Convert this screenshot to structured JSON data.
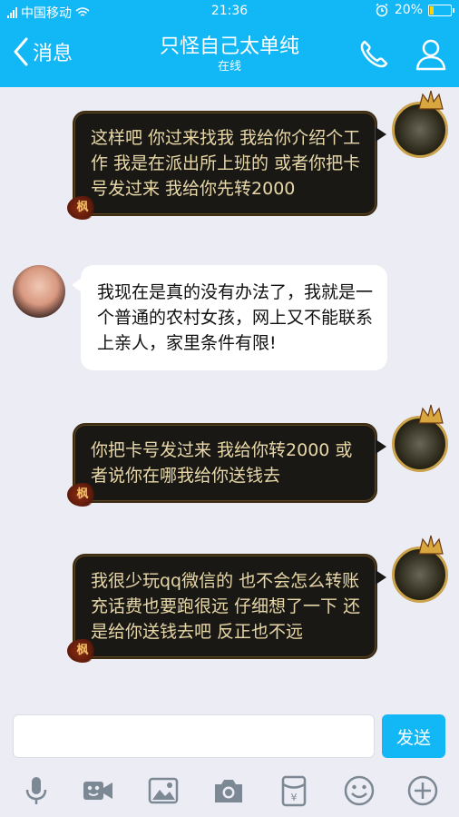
{
  "status": {
    "carrier": "中国移动",
    "time": "21:36",
    "battery": "20%",
    "battery_level": 0.2
  },
  "nav": {
    "back_label": "消息",
    "title": "只怪自己太单纯",
    "subtitle": "在线",
    "phone_icon": "phone-icon",
    "profile_icon": "user-icon"
  },
  "messages": [
    {
      "side": "self",
      "text": "这样吧 你过来找我 我给你介绍个工作 我是在派出所上班的 或者你把卡号发过来 我给你先转2000"
    },
    {
      "side": "other",
      "text": "我现在是真的没有办法了，我就是一个普通的农村女孩，网上又不能联系上亲人，家里条件有限!"
    },
    {
      "side": "self",
      "text": "你把卡号发过来 我给你转2000 或者说你在哪我给你送钱去"
    },
    {
      "side": "self",
      "text": "我很少玩qq微信的 也不会怎么转账 充话费也要跑很远 仔细想了一下 还是给你送钱去吧 反正也不远"
    }
  ],
  "input": {
    "value": "",
    "send_label": "发送"
  },
  "toolbar": [
    "mic-icon",
    "video-icon",
    "image-icon",
    "camera-icon",
    "red-packet-icon",
    "emoji-icon",
    "plus-icon"
  ],
  "colors": {
    "accent": "#12b7f5",
    "dark_bubble": "#1a1814",
    "dark_bubble_text": "#e8d8a8",
    "background": "#ececf4"
  }
}
